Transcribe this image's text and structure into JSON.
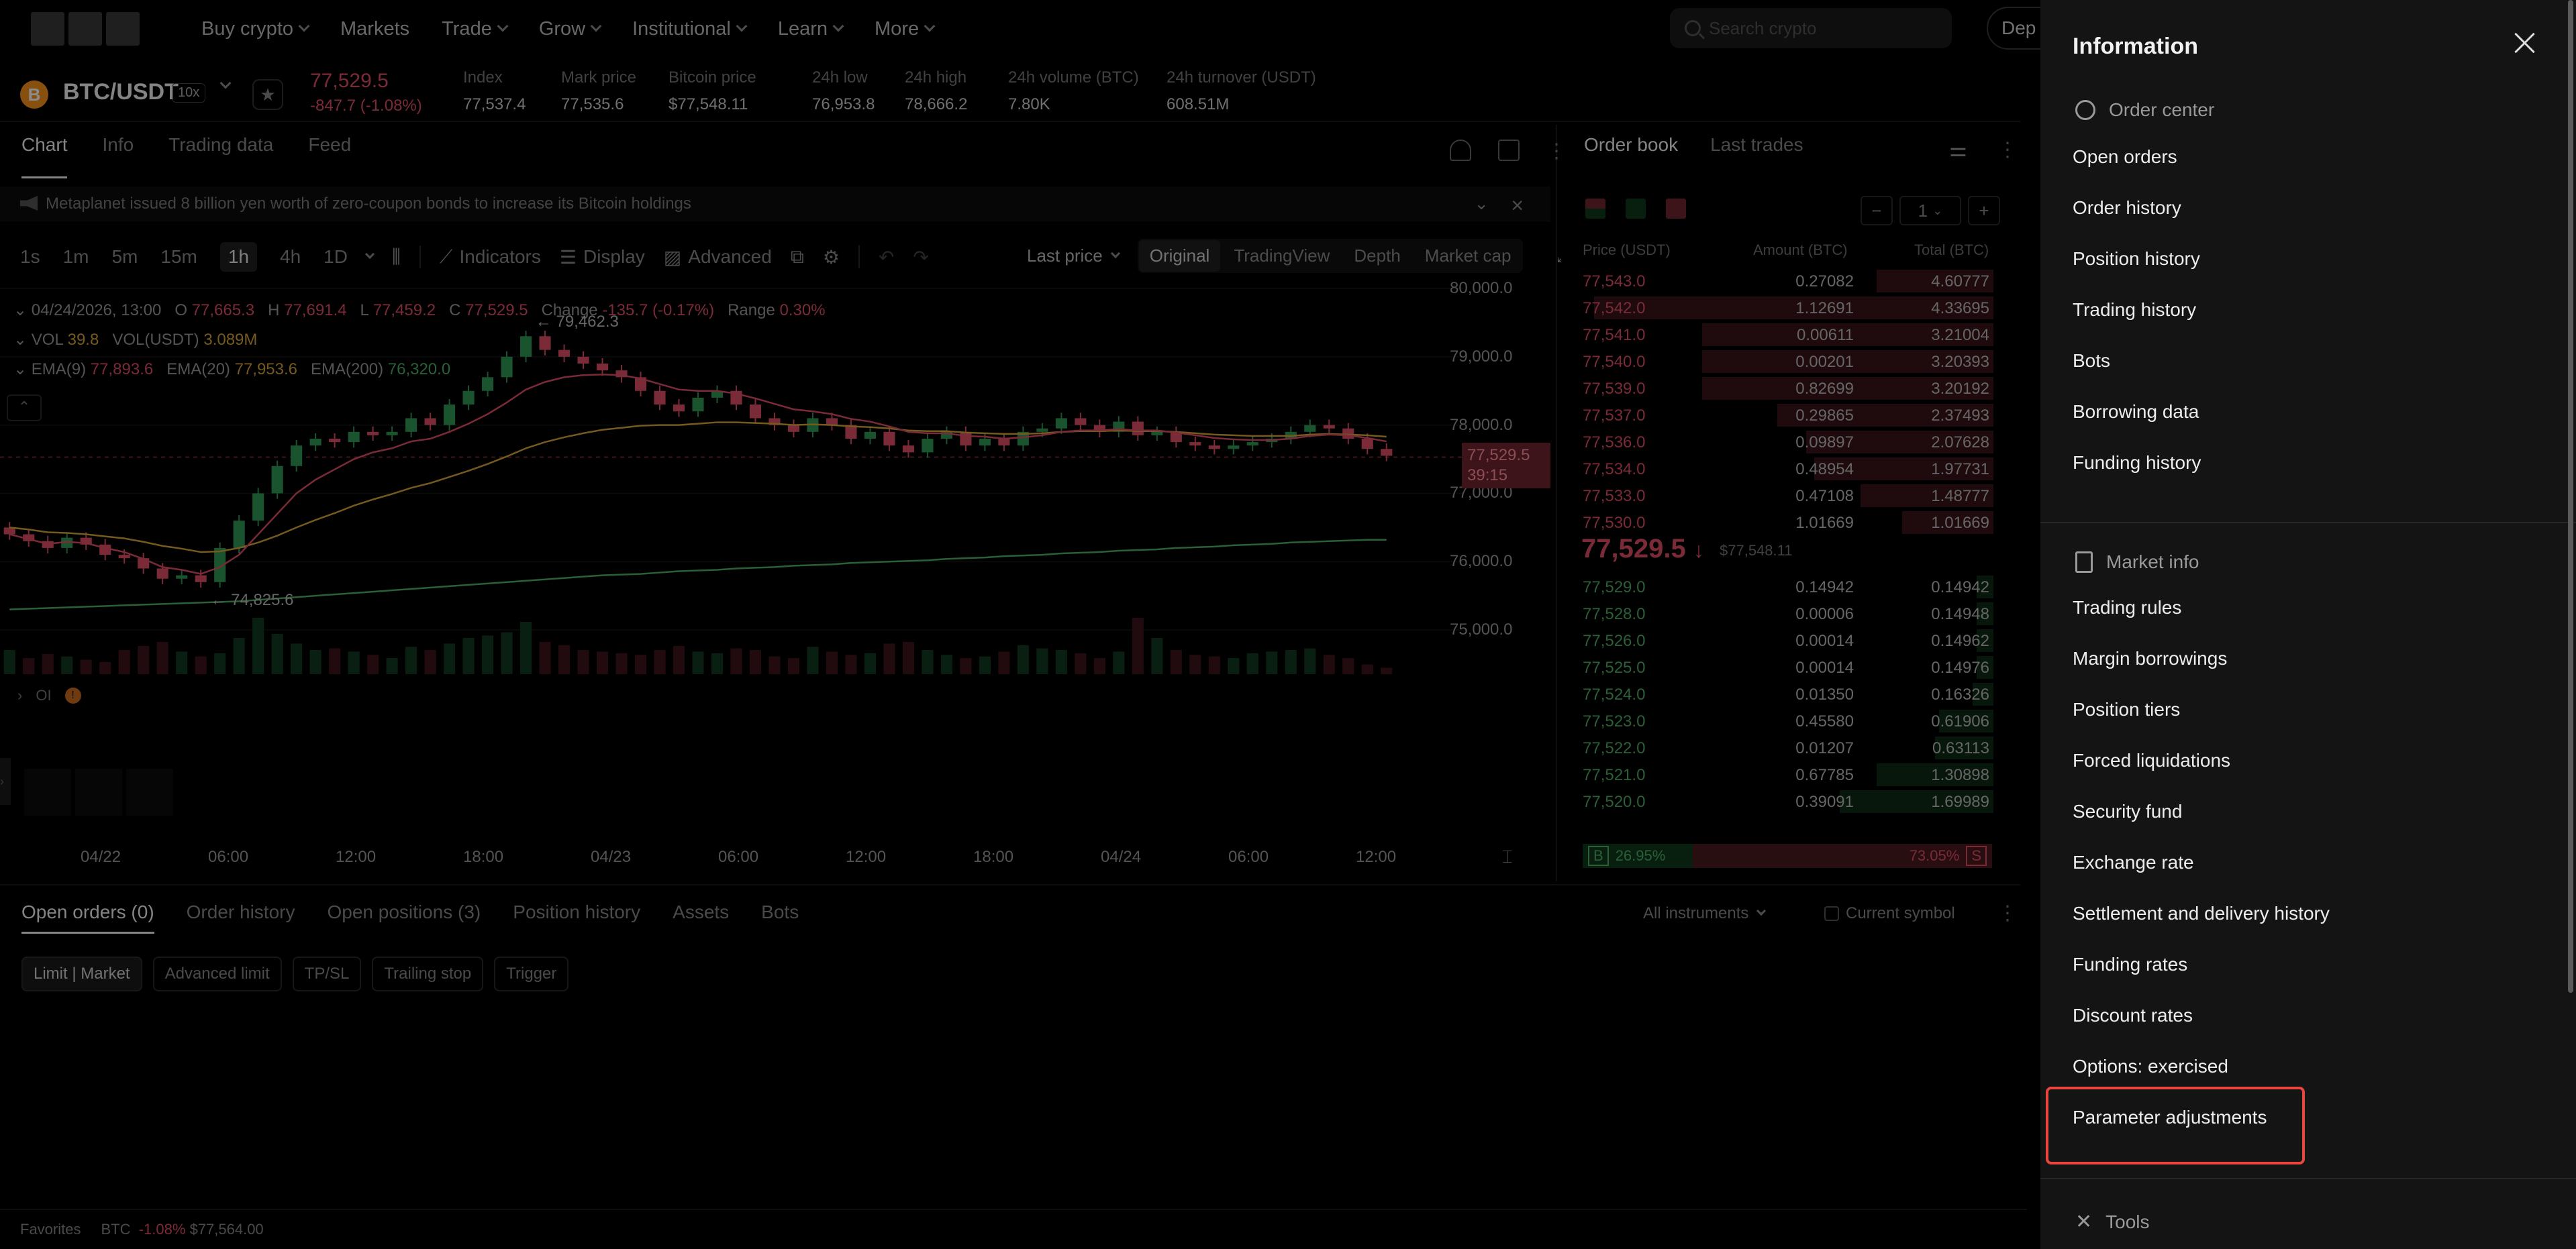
{
  "nav": {
    "items": [
      "Buy crypto",
      "Markets",
      "Trade",
      "Grow",
      "Institutional",
      "Learn",
      "More"
    ],
    "has_chevron": [
      true,
      false,
      true,
      true,
      true,
      true,
      true
    ],
    "search_placeholder": "Search crypto",
    "deposit_label": "Dep"
  },
  "ticker": {
    "coin_letter": "B",
    "pair": "BTC/USDT",
    "leverage": "10x",
    "price": "77,529.5",
    "change": "-847.7 (-1.08%)",
    "stats": [
      {
        "label": "Index",
        "value": "77,537.4"
      },
      {
        "label": "Mark price",
        "value": "77,535.6"
      },
      {
        "label": "Bitcoin price",
        "value": "$77,548.11"
      },
      {
        "label": "24h low",
        "value": "76,953.8"
      },
      {
        "label": "24h high",
        "value": "78,666.2"
      },
      {
        "label": "24h volume (BTC)",
        "value": "7.80K"
      },
      {
        "label": "24h turnover (USDT)",
        "value": "608.51M"
      }
    ]
  },
  "chart_tabs": [
    "Chart",
    "Info",
    "Trading data",
    "Feed"
  ],
  "news": "Metaplanet issued 8 billion yen worth of zero-coupon bonds to increase its Bitcoin holdings",
  "toolbar": {
    "timeframes": [
      "1s",
      "1m",
      "5m",
      "15m",
      "1h",
      "4h",
      "1D"
    ],
    "active_timeframe": "1h",
    "indicators": "Indicators",
    "display": "Display",
    "advanced": "Advanced",
    "price_type": "Last price",
    "views": [
      "Original",
      "TradingView",
      "Depth",
      "Market cap"
    ]
  },
  "legend": {
    "date": "04/24/2026, 13:00",
    "o": "77,665.3",
    "h": "77,691.4",
    "l": "77,459.2",
    "c": "77,529.5",
    "change_label": "Change",
    "change": "-135.7 (-0.17%)",
    "range_label": "Range",
    "range": "0.30%",
    "vol_label": "VOL",
    "vol": "39.8",
    "vol_usdt_label": "VOL(USDT)",
    "vol_usdt": "3.089M",
    "ema9_label": "EMA(9)",
    "ema9": "77,893.6",
    "ema20_label": "EMA(20)",
    "ema20": "77,953.6",
    "ema200_label": "EMA(200)",
    "ema200": "76,320.0",
    "high_marker": "← 79,462.3",
    "low_marker": "← 74,825.6",
    "oi_label": "OI",
    "oi_badge": "!"
  },
  "chart_data": {
    "type": "candlestick",
    "y_ticks": [
      "80,000.0",
      "79,000.0",
      "78,000.0",
      "77,000.0",
      "76,000.0",
      "75,000.0"
    ],
    "ylim": [
      74500,
      80000
    ],
    "x_ticks": [
      "04/22",
      "06:00",
      "12:00",
      "18:00",
      "04/23",
      "06:00",
      "12:00",
      "18:00",
      "04/24",
      "06:00",
      "12:00"
    ],
    "last_price": "77,529.5",
    "countdown": "39:15",
    "closes": [
      76400,
      76300,
      76200,
      76350,
      76250,
      76100,
      76050,
      75900,
      75750,
      75800,
      75700,
      76200,
      76600,
      77000,
      77400,
      77700,
      77800,
      77750,
      77900,
      77850,
      77900,
      78100,
      78000,
      78300,
      78500,
      78700,
      79000,
      79300,
      79100,
      79000,
      78900,
      78800,
      78700,
      78500,
      78300,
      78200,
      78400,
      78500,
      78300,
      78100,
      78000,
      77900,
      78100,
      78000,
      77800,
      77900,
      77700,
      77600,
      77800,
      77900,
      77700,
      77800,
      77700,
      77900,
      77950,
      78100,
      78000,
      77900,
      78050,
      77850,
      77900,
      77750,
      77700,
      77650,
      77700,
      77750,
      77800,
      77900,
      78000,
      77950,
      77800,
      77650,
      77550
    ],
    "volumes": [
      30,
      20,
      25,
      22,
      18,
      15,
      30,
      35,
      40,
      28,
      22,
      26,
      45,
      70,
      50,
      38,
      30,
      32,
      28,
      24,
      20,
      34,
      30,
      38,
      45,
      48,
      52,
      65,
      40,
      36,
      30,
      28,
      26,
      24,
      30,
      35,
      28,
      26,
      32,
      30,
      22,
      20,
      34,
      28,
      24,
      26,
      38,
      40,
      30,
      24,
      20,
      22,
      28,
      36,
      32,
      30,
      26,
      20,
      28,
      70,
      45,
      30,
      24,
      22,
      20,
      26,
      28,
      30,
      32,
      24,
      20,
      12,
      8
    ],
    "ema9": [
      76400,
      76330,
      76260,
      76290,
      76270,
      76200,
      76140,
      76040,
      75920,
      75880,
      75820,
      75920,
      76100,
      76400,
      76700,
      77000,
      77200,
      77350,
      77500,
      77600,
      77660,
      77760,
      77800,
      77900,
      78020,
      78160,
      78330,
      78520,
      78630,
      78700,
      78730,
      78740,
      78730,
      78680,
      78600,
      78520,
      78500,
      78500,
      78460,
      78390,
      78310,
      78230,
      78200,
      78160,
      78090,
      78050,
      77980,
      77900,
      77880,
      77880,
      77840,
      77830,
      77800,
      77820,
      77850,
      77900,
      77920,
      77920,
      77940,
      77920,
      77920,
      77890,
      77850,
      77810,
      77790,
      77780,
      77780,
      77800,
      77840,
      77860,
      77850,
      77810,
      77760
    ],
    "ema20": [
      76500,
      76470,
      76430,
      76420,
      76400,
      76370,
      76340,
      76290,
      76230,
      76190,
      76140,
      76150,
      76200,
      76280,
      76380,
      76500,
      76610,
      76710,
      76820,
      76910,
      76990,
      77080,
      77150,
      77240,
      77330,
      77430,
      77540,
      77660,
      77750,
      77820,
      77880,
      77930,
      77960,
      77990,
      78000,
      78000,
      78020,
      78040,
      78040,
      78030,
      78020,
      78000,
      78010,
      78000,
      77980,
      77970,
      77950,
      77920,
      77910,
      77910,
      77890,
      77880,
      77870,
      77870,
      77880,
      77900,
      77910,
      77910,
      77920,
      77910,
      77910,
      77900,
      77880,
      77860,
      77850,
      77840,
      77840,
      77840,
      77860,
      77870,
      77860,
      77850,
      77830
    ],
    "ema200": [
      75300,
      75310,
      75320,
      75330,
      75340,
      75350,
      75360,
      75370,
      75380,
      75390,
      75400,
      75410,
      75420,
      75440,
      75460,
      75480,
      75500,
      75520,
      75540,
      75560,
      75580,
      75600,
      75620,
      75640,
      75660,
      75680,
      75700,
      75720,
      75740,
      75760,
      75780,
      75800,
      75810,
      75820,
      75840,
      75860,
      75870,
      75880,
      75900,
      75910,
      75920,
      75940,
      75950,
      75960,
      75980,
      75990,
      76000,
      76010,
      76020,
      76040,
      76050,
      76060,
      76080,
      76090,
      76100,
      76120,
      76130,
      76140,
      76160,
      76170,
      76180,
      76200,
      76210,
      76220,
      76240,
      76250,
      76260,
      76280,
      76290,
      76300,
      76310,
      76320,
      76320
    ]
  },
  "orderbook": {
    "tabs": [
      "Order book",
      "Last trades"
    ],
    "step_value": "1",
    "headers": [
      "Price (USDT)",
      "Amount (BTC)",
      "Total (BTC)"
    ],
    "asks": [
      {
        "price": "77,543.0",
        "amount": "0.27082",
        "total": "4.60777",
        "depth": 0.28
      },
      {
        "price": "77,542.0",
        "amount": "1.12691",
        "total": "4.33695",
        "depth": 0.96
      },
      {
        "price": "77,541.0",
        "amount": "0.00611",
        "total": "3.21004",
        "depth": 0.7
      },
      {
        "price": "77,540.0",
        "amount": "0.00201",
        "total": "3.20393",
        "depth": 0.7
      },
      {
        "price": "77,539.0",
        "amount": "0.82699",
        "total": "3.20192",
        "depth": 0.7
      },
      {
        "price": "77,537.0",
        "amount": "0.29865",
        "total": "2.37493",
        "depth": 0.52
      },
      {
        "price": "77,536.0",
        "amount": "0.09897",
        "total": "2.07628",
        "depth": 0.45
      },
      {
        "price": "77,534.0",
        "amount": "0.48954",
        "total": "1.97731",
        "depth": 0.43
      },
      {
        "price": "77,533.0",
        "amount": "0.47108",
        "total": "1.48777",
        "depth": 0.32
      },
      {
        "price": "77,530.0",
        "amount": "1.01669",
        "total": "1.01669",
        "depth": 0.22
      }
    ],
    "mid_price": "77,529.5",
    "mid_arrow": "↓",
    "mid_sub": "$77,548.11",
    "bids": [
      {
        "price": "77,529.0",
        "amount": "0.14942",
        "total": "0.14942",
        "depth": 0.04
      },
      {
        "price": "77,528.0",
        "amount": "0.00006",
        "total": "0.14948",
        "depth": 0.04
      },
      {
        "price": "77,526.0",
        "amount": "0.00014",
        "total": "0.14962",
        "depth": 0.04
      },
      {
        "price": "77,525.0",
        "amount": "0.00014",
        "total": "0.14976",
        "depth": 0.04
      },
      {
        "price": "77,524.0",
        "amount": "0.01350",
        "total": "0.16326",
        "depth": 0.05
      },
      {
        "price": "77,523.0",
        "amount": "0.45580",
        "total": "0.61906",
        "depth": 0.13
      },
      {
        "price": "77,522.0",
        "amount": "0.01207",
        "total": "0.63113",
        "depth": 0.14
      },
      {
        "price": "77,521.0",
        "amount": "0.67785",
        "total": "1.30898",
        "depth": 0.28
      },
      {
        "price": "77,520.0",
        "amount": "0.39091",
        "total": "1.69989",
        "depth": 0.37
      }
    ],
    "buy_label": "B",
    "buy_pct": "26.95%",
    "buy_fraction": 0.2695,
    "sell_label": "S",
    "sell_pct": "73.05%"
  },
  "bottom": {
    "tabs": [
      "Open orders (0)",
      "Order history",
      "Open positions (3)",
      "Position history",
      "Assets",
      "Bots"
    ],
    "chips": [
      "Limit | Market",
      "Advanced limit",
      "TP/SL",
      "Trailing stop",
      "Trigger"
    ],
    "instrument_filter": "All instruments",
    "current_symbol": "Current symbol"
  },
  "footer": {
    "favorites": "Favorites",
    "symbol": "BTC",
    "change": "-1.08%",
    "price": "$77,564.00"
  },
  "drawer": {
    "title": "Information",
    "order_center": {
      "heading": "Order center",
      "items": [
        "Open orders",
        "Order history",
        "Position history",
        "Trading history",
        "Bots",
        "Borrowing data",
        "Funding history"
      ]
    },
    "market_info": {
      "heading": "Market info",
      "items": [
        "Trading rules",
        "Margin borrowings",
        "Position tiers",
        "Forced liquidations",
        "Security fund",
        "Exchange rate",
        "Settlement and delivery history",
        "Funding rates",
        "Discount rates",
        "Options: exercised",
        "Parameter adjustments"
      ]
    },
    "tools": {
      "heading": "Tools"
    }
  },
  "colors": {
    "up": "#2e9a57",
    "down": "#e04f64",
    "ema9": "#e04f64",
    "ema20": "#d6a33a",
    "ema200": "#4fae67",
    "highlight": "#e8473f"
  }
}
